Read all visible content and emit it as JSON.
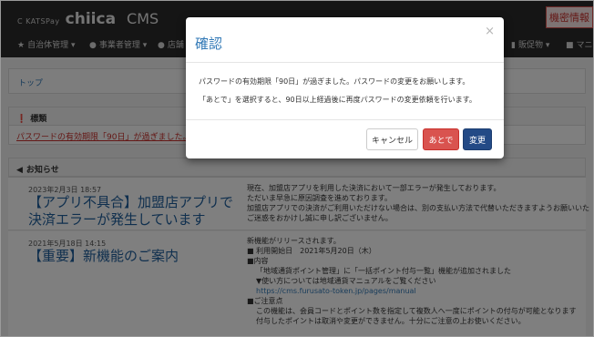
{
  "navbar": {
    "brand_pre": "C KATSPay",
    "brand_main": "chiica",
    "brand_cms": "CMS",
    "items": [
      {
        "label": "自治体管理 ▾",
        "icon": "star-icon"
      },
      {
        "label": "事業者管理 ▾",
        "icon": "user-icon"
      },
      {
        "label": "店舗",
        "icon": "user-icon"
      },
      {
        "label": "販促物 ▾",
        "icon": "file-icon"
      },
      {
        "label": "マニ",
        "icon": "square-icon"
      }
    ],
    "right_button": "機密情報"
  },
  "breadcrumb": {
    "label": "トップ"
  },
  "alert_panel": {
    "title": "標類",
    "link_text": "パスワードの有効期限「90日」が過ぎました。パ"
  },
  "news_panel": {
    "title": "お知らせ",
    "items": [
      {
        "date": "2023年2月3日 18:57",
        "title": "【アプリ不具合】加盟店アプリで決済エラーが発生しています",
        "body": [
          "現在、加盟店アプリを利用した決済において一部エラーが発生しております。",
          "ただいま早急に原因調査を進めております。",
          "加盟店アプリでの決済がご利用いただけない場合は、別の支払い方法で代替いただきますようお願いいた",
          "ご迷惑をおかけし誠に申し訳ございません。"
        ]
      },
      {
        "date": "2021年5月18日 14:15",
        "title": "【重要】新機能のご案内",
        "body": [
          "新機能がリリースされます。",
          "■ 利用開始日　2021年5月20日（木）",
          "■内容",
          "「地域通貨ポイント管理」に「一括ポイント付与一覧」機能が追加されました",
          "▼使い方については地域通貨マニュアルをご覧ください",
          "https://cms.furusato-token.jp/pages/manual",
          "■ご注意点",
          "この機能は、会員コードとポイント数を指定して複数人へ一度にポイントの付与が可能となります",
          "付与したポイントは取消や変更ができません。十分にご注意の上お使いください。"
        ]
      }
    ]
  },
  "modal": {
    "title": "確認",
    "close": "×",
    "message_1": "パスワードの有効期限「90日」が過ぎました。パスワードの変更をお願いします。",
    "message_2": "「あとで」を選択すると、90日以上経過後に再度パスワードの変更依頼を行います。",
    "cancel_label": "キャンセル",
    "later_label": "あとで",
    "change_label": "変更"
  },
  "colors": {
    "navbar": "#2b2b2b",
    "accent_blue": "#337ab7",
    "danger": "#d9534f",
    "primary_dark": "#234a86"
  }
}
